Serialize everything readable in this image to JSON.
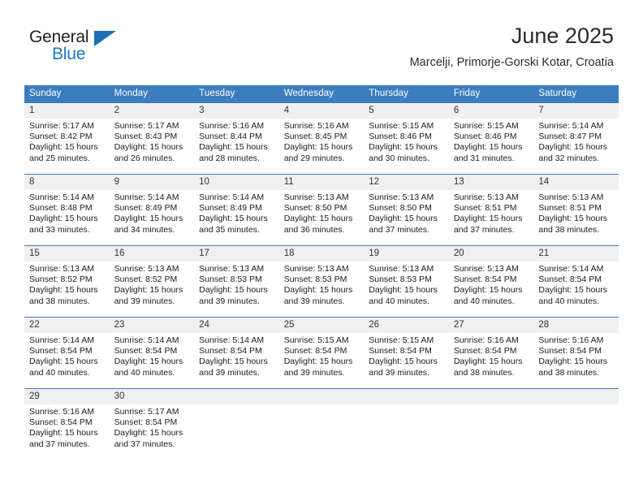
{
  "brand": {
    "name_part1": "General",
    "name_part2": "Blue",
    "flag_icon": "triangle-flag-icon",
    "accent_color": "#1c70b8"
  },
  "header": {
    "title": "June 2025",
    "subtitle": "Marcelji, Primorje-Gorski Kotar, Croatia"
  },
  "theme": {
    "header_bg": "#3b7dbf",
    "daynum_bg": "#f0f0f0",
    "text_color": "#1c1c1c"
  },
  "weekday_headers": [
    "Sunday",
    "Monday",
    "Tuesday",
    "Wednesday",
    "Thursday",
    "Friday",
    "Saturday"
  ],
  "weeks": [
    [
      {
        "day": "1",
        "sunrise": "Sunrise: 5:17 AM",
        "sunset": "Sunset: 8:42 PM",
        "daylight_line1": "Daylight: 15 hours",
        "daylight_line2": "and 25 minutes."
      },
      {
        "day": "2",
        "sunrise": "Sunrise: 5:17 AM",
        "sunset": "Sunset: 8:43 PM",
        "daylight_line1": "Daylight: 15 hours",
        "daylight_line2": "and 26 minutes."
      },
      {
        "day": "3",
        "sunrise": "Sunrise: 5:16 AM",
        "sunset": "Sunset: 8:44 PM",
        "daylight_line1": "Daylight: 15 hours",
        "daylight_line2": "and 28 minutes."
      },
      {
        "day": "4",
        "sunrise": "Sunrise: 5:16 AM",
        "sunset": "Sunset: 8:45 PM",
        "daylight_line1": "Daylight: 15 hours",
        "daylight_line2": "and 29 minutes."
      },
      {
        "day": "5",
        "sunrise": "Sunrise: 5:15 AM",
        "sunset": "Sunset: 8:46 PM",
        "daylight_line1": "Daylight: 15 hours",
        "daylight_line2": "and 30 minutes."
      },
      {
        "day": "6",
        "sunrise": "Sunrise: 5:15 AM",
        "sunset": "Sunset: 8:46 PM",
        "daylight_line1": "Daylight: 15 hours",
        "daylight_line2": "and 31 minutes."
      },
      {
        "day": "7",
        "sunrise": "Sunrise: 5:14 AM",
        "sunset": "Sunset: 8:47 PM",
        "daylight_line1": "Daylight: 15 hours",
        "daylight_line2": "and 32 minutes."
      }
    ],
    [
      {
        "day": "8",
        "sunrise": "Sunrise: 5:14 AM",
        "sunset": "Sunset: 8:48 PM",
        "daylight_line1": "Daylight: 15 hours",
        "daylight_line2": "and 33 minutes."
      },
      {
        "day": "9",
        "sunrise": "Sunrise: 5:14 AM",
        "sunset": "Sunset: 8:49 PM",
        "daylight_line1": "Daylight: 15 hours",
        "daylight_line2": "and 34 minutes."
      },
      {
        "day": "10",
        "sunrise": "Sunrise: 5:14 AM",
        "sunset": "Sunset: 8:49 PM",
        "daylight_line1": "Daylight: 15 hours",
        "daylight_line2": "and 35 minutes."
      },
      {
        "day": "11",
        "sunrise": "Sunrise: 5:13 AM",
        "sunset": "Sunset: 8:50 PM",
        "daylight_line1": "Daylight: 15 hours",
        "daylight_line2": "and 36 minutes."
      },
      {
        "day": "12",
        "sunrise": "Sunrise: 5:13 AM",
        "sunset": "Sunset: 8:50 PM",
        "daylight_line1": "Daylight: 15 hours",
        "daylight_line2": "and 37 minutes."
      },
      {
        "day": "13",
        "sunrise": "Sunrise: 5:13 AM",
        "sunset": "Sunset: 8:51 PM",
        "daylight_line1": "Daylight: 15 hours",
        "daylight_line2": "and 37 minutes."
      },
      {
        "day": "14",
        "sunrise": "Sunrise: 5:13 AM",
        "sunset": "Sunset: 8:51 PM",
        "daylight_line1": "Daylight: 15 hours",
        "daylight_line2": "and 38 minutes."
      }
    ],
    [
      {
        "day": "15",
        "sunrise": "Sunrise: 5:13 AM",
        "sunset": "Sunset: 8:52 PM",
        "daylight_line1": "Daylight: 15 hours",
        "daylight_line2": "and 38 minutes."
      },
      {
        "day": "16",
        "sunrise": "Sunrise: 5:13 AM",
        "sunset": "Sunset: 8:52 PM",
        "daylight_line1": "Daylight: 15 hours",
        "daylight_line2": "and 39 minutes."
      },
      {
        "day": "17",
        "sunrise": "Sunrise: 5:13 AM",
        "sunset": "Sunset: 8:53 PM",
        "daylight_line1": "Daylight: 15 hours",
        "daylight_line2": "and 39 minutes."
      },
      {
        "day": "18",
        "sunrise": "Sunrise: 5:13 AM",
        "sunset": "Sunset: 8:53 PM",
        "daylight_line1": "Daylight: 15 hours",
        "daylight_line2": "and 39 minutes."
      },
      {
        "day": "19",
        "sunrise": "Sunrise: 5:13 AM",
        "sunset": "Sunset: 8:53 PM",
        "daylight_line1": "Daylight: 15 hours",
        "daylight_line2": "and 40 minutes."
      },
      {
        "day": "20",
        "sunrise": "Sunrise: 5:13 AM",
        "sunset": "Sunset: 8:54 PM",
        "daylight_line1": "Daylight: 15 hours",
        "daylight_line2": "and 40 minutes."
      },
      {
        "day": "21",
        "sunrise": "Sunrise: 5:14 AM",
        "sunset": "Sunset: 8:54 PM",
        "daylight_line1": "Daylight: 15 hours",
        "daylight_line2": "and 40 minutes."
      }
    ],
    [
      {
        "day": "22",
        "sunrise": "Sunrise: 5:14 AM",
        "sunset": "Sunset: 8:54 PM",
        "daylight_line1": "Daylight: 15 hours",
        "daylight_line2": "and 40 minutes."
      },
      {
        "day": "23",
        "sunrise": "Sunrise: 5:14 AM",
        "sunset": "Sunset: 8:54 PM",
        "daylight_line1": "Daylight: 15 hours",
        "daylight_line2": "and 40 minutes."
      },
      {
        "day": "24",
        "sunrise": "Sunrise: 5:14 AM",
        "sunset": "Sunset: 8:54 PM",
        "daylight_line1": "Daylight: 15 hours",
        "daylight_line2": "and 39 minutes."
      },
      {
        "day": "25",
        "sunrise": "Sunrise: 5:15 AM",
        "sunset": "Sunset: 8:54 PM",
        "daylight_line1": "Daylight: 15 hours",
        "daylight_line2": "and 39 minutes."
      },
      {
        "day": "26",
        "sunrise": "Sunrise: 5:15 AM",
        "sunset": "Sunset: 8:54 PM",
        "daylight_line1": "Daylight: 15 hours",
        "daylight_line2": "and 39 minutes."
      },
      {
        "day": "27",
        "sunrise": "Sunrise: 5:16 AM",
        "sunset": "Sunset: 8:54 PM",
        "daylight_line1": "Daylight: 15 hours",
        "daylight_line2": "and 38 minutes."
      },
      {
        "day": "28",
        "sunrise": "Sunrise: 5:16 AM",
        "sunset": "Sunset: 8:54 PM",
        "daylight_line1": "Daylight: 15 hours",
        "daylight_line2": "and 38 minutes."
      }
    ],
    [
      {
        "day": "29",
        "sunrise": "Sunrise: 5:16 AM",
        "sunset": "Sunset: 8:54 PM",
        "daylight_line1": "Daylight: 15 hours",
        "daylight_line2": "and 37 minutes."
      },
      {
        "day": "30",
        "sunrise": "Sunrise: 5:17 AM",
        "sunset": "Sunset: 8:54 PM",
        "daylight_line1": "Daylight: 15 hours",
        "daylight_line2": "and 37 minutes."
      },
      {
        "day": "",
        "sunrise": "",
        "sunset": "",
        "daylight_line1": "",
        "daylight_line2": ""
      },
      {
        "day": "",
        "sunrise": "",
        "sunset": "",
        "daylight_line1": "",
        "daylight_line2": ""
      },
      {
        "day": "",
        "sunrise": "",
        "sunset": "",
        "daylight_line1": "",
        "daylight_line2": ""
      },
      {
        "day": "",
        "sunrise": "",
        "sunset": "",
        "daylight_line1": "",
        "daylight_line2": ""
      },
      {
        "day": "",
        "sunrise": "",
        "sunset": "",
        "daylight_line1": "",
        "daylight_line2": ""
      }
    ]
  ]
}
